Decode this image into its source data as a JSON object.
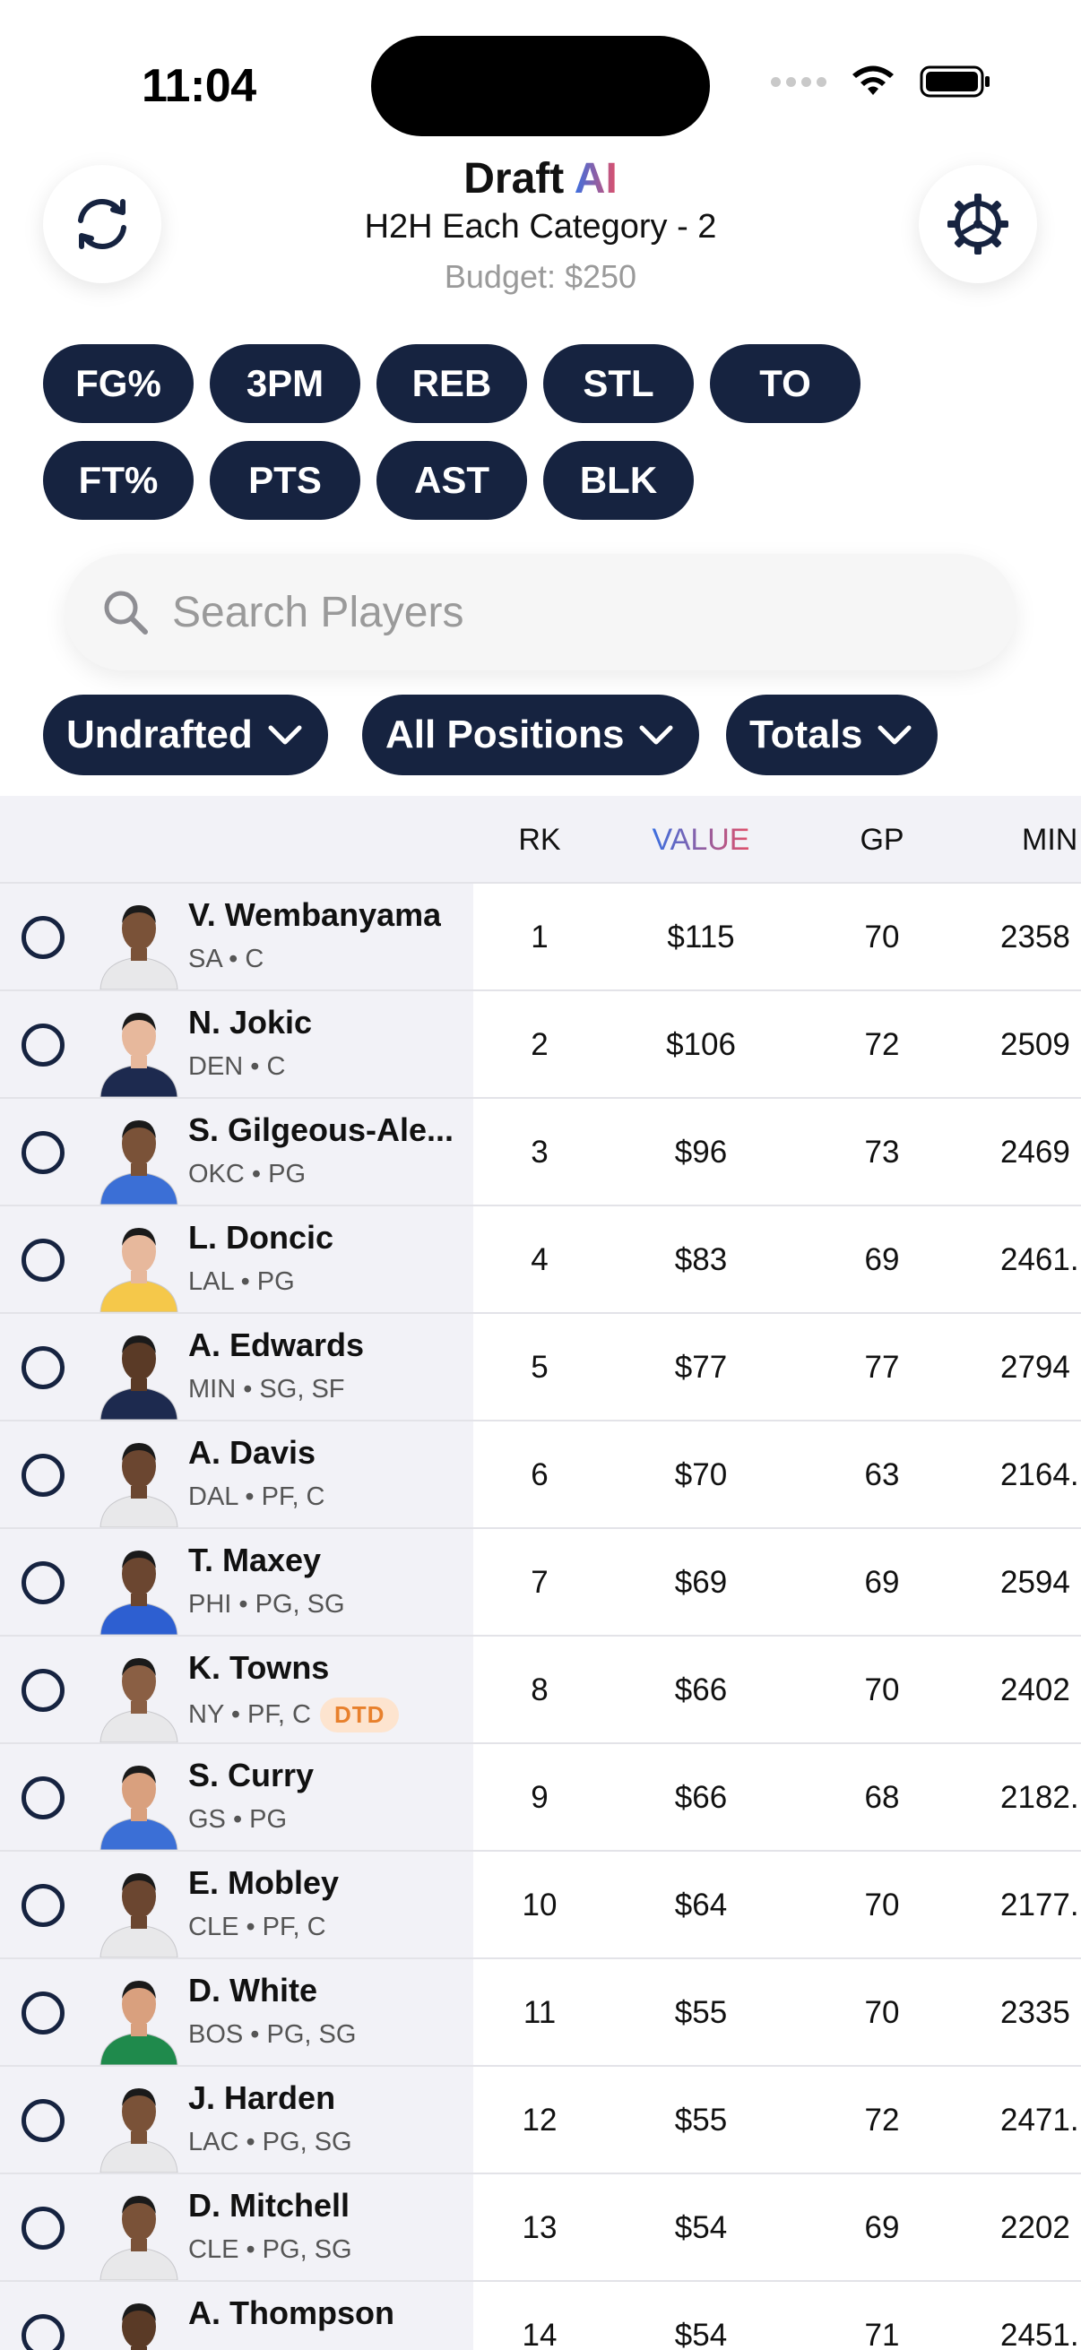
{
  "status_bar": {
    "time": "11:04"
  },
  "header": {
    "title_main": "Draft ",
    "title_ai": "AI",
    "league": "H2H Each Category - 2",
    "budget": "Budget: $250"
  },
  "categories": [
    "FG%",
    "3PM",
    "REB",
    "STL",
    "TO",
    "FT%",
    "PTS",
    "AST",
    "BLK"
  ],
  "search": {
    "placeholder": "Search Players",
    "value": ""
  },
  "filters": {
    "status": "Undrafted",
    "positions": "All Positions",
    "stat_mode": "Totals"
  },
  "table": {
    "columns": {
      "rank": "RK",
      "value": "VALUE",
      "games": "GP",
      "minutes": "MIN"
    },
    "rows": [
      {
        "name": "V. Wembanyama",
        "team_pos": "SA • C",
        "badge": "",
        "rk": "1",
        "value": "$115",
        "gp": "70",
        "min": "2358"
      },
      {
        "name": "N. Jokic",
        "team_pos": "DEN • C",
        "badge": "",
        "rk": "2",
        "value": "$106",
        "gp": "72",
        "min": "2509"
      },
      {
        "name": "S. Gilgeous-Ale...",
        "team_pos": "OKC • PG",
        "badge": "",
        "rk": "3",
        "value": "$96",
        "gp": "73",
        "min": "2469"
      },
      {
        "name": "L. Doncic",
        "team_pos": "LAL • PG",
        "badge": "",
        "rk": "4",
        "value": "$83",
        "gp": "69",
        "min": "2461."
      },
      {
        "name": "A. Edwards",
        "team_pos": "MIN • SG, SF",
        "badge": "",
        "rk": "5",
        "value": "$77",
        "gp": "77",
        "min": "2794"
      },
      {
        "name": "A. Davis",
        "team_pos": "DAL • PF, C",
        "badge": "",
        "rk": "6",
        "value": "$70",
        "gp": "63",
        "min": "2164."
      },
      {
        "name": "T. Maxey",
        "team_pos": "PHI • PG, SG",
        "badge": "",
        "rk": "7",
        "value": "$69",
        "gp": "69",
        "min": "2594"
      },
      {
        "name": "K. Towns",
        "team_pos": "NY • PF, C",
        "badge": "DTD",
        "rk": "8",
        "value": "$66",
        "gp": "70",
        "min": "2402"
      },
      {
        "name": "S. Curry",
        "team_pos": "GS • PG",
        "badge": "",
        "rk": "9",
        "value": "$66",
        "gp": "68",
        "min": "2182."
      },
      {
        "name": "E. Mobley",
        "team_pos": "CLE • PF, C",
        "badge": "",
        "rk": "10",
        "value": "$64",
        "gp": "70",
        "min": "2177."
      },
      {
        "name": "D. White",
        "team_pos": "BOS • PG, SG",
        "badge": "",
        "rk": "11",
        "value": "$55",
        "gp": "70",
        "min": "2335"
      },
      {
        "name": "J. Harden",
        "team_pos": "LAC • PG, SG",
        "badge": "",
        "rk": "12",
        "value": "$55",
        "gp": "72",
        "min": "2471."
      },
      {
        "name": "D. Mitchell",
        "team_pos": "CLE • PG, SG",
        "badge": "",
        "rk": "13",
        "value": "$54",
        "gp": "69",
        "min": "2202"
      },
      {
        "name": "A. Thompson",
        "team_pos": "",
        "badge": "",
        "rk": "14",
        "value": "$54",
        "gp": "71",
        "min": "2451."
      }
    ]
  },
  "colors": {
    "chip_bg": "#162340",
    "accent_blue": "#3b6fe0",
    "accent_pink": "#e0506a",
    "dtd_badge": "#e8802c",
    "jerseys": [
      "#e8e8ea",
      "#1d2a4f",
      "#3b6fd6",
      "#f5c84a",
      "#1d2a4f",
      "#e8e8ea",
      "#2d5fd1",
      "#e8e8ea",
      "#3b6fd6",
      "#e8e8ea",
      "#1f8a4c",
      "#e8e8ea",
      "#e8e8ea",
      "#1d2a4f"
    ],
    "skins": [
      "#7a5238",
      "#e7b89c",
      "#7a5238",
      "#e7b89c",
      "#5a3a26",
      "#6b4630",
      "#6b4630",
      "#8a5f44",
      "#d9a07e",
      "#6b4630",
      "#d9a07e",
      "#7a5238",
      "#7a5238",
      "#5a3a26"
    ]
  }
}
